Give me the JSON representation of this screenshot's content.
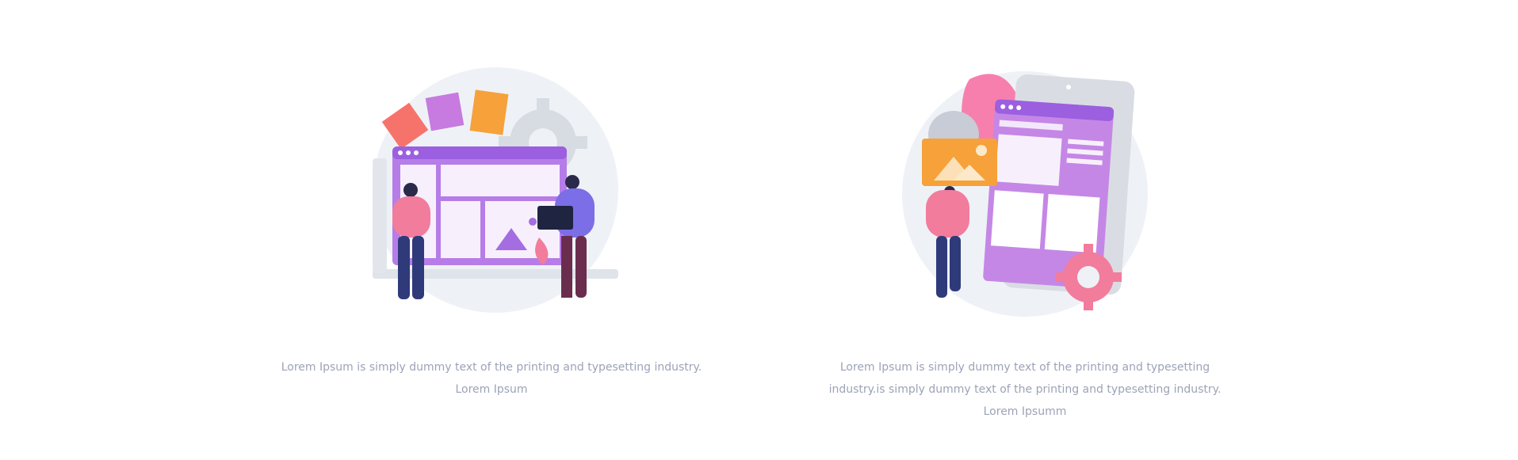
{
  "cards": [
    {
      "illustration_icon": "web-design-team-illustration",
      "caption": "Lorem Ipsum is simply dummy text of the printing and typesetting industry. Lorem Ipsum"
    },
    {
      "illustration_icon": "mobile-app-design-illustration",
      "caption": "Lorem Ipsum is simply dummy text of the printing and typesetting industry.is simply dummy text of the printing and typesetting industry. Lorem Ipsumm"
    }
  ],
  "colors": {
    "caption_text": "#9ca3b8",
    "accent_purple": "#a56de2",
    "accent_pink": "#f27c9c",
    "accent_orange": "#f6a13a",
    "bg_blob": "#eef2f7"
  }
}
